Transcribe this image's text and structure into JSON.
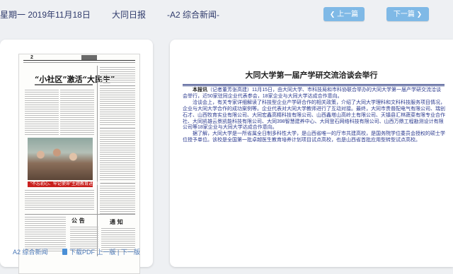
{
  "header": {
    "date": "星期一 2019年11月18日",
    "paper_name": "大同日报",
    "page_label": "-A2 综合新闻-",
    "prev_label": "上一篇",
    "next_label": "下一篇",
    "button_color": "#7fb9e6"
  },
  "thumbnail": {
    "page_number": "2",
    "headline": "“小社区”激活“大民生”",
    "red_band_text": "“不忘初心、牢记使命”主题教育进行时",
    "notices": [
      "公  告",
      "通  知"
    ],
    "footer_page": "A2 综合新闻",
    "footer_links": "下载PDF 上一版 | 下一版"
  },
  "article": {
    "title": "大同大学第一届产学研交流洽谈会举行",
    "lead": "本报讯",
    "paragraphs": [
      "（记者董芳张高建）11月15日，由大同大学、市科技局和市科协联合举办的大同大学第一届产学研交流洽谈会举行，近50家驻同企业代表参会，18家企业与大同大学达成合作意向。",
      "洽谈会上，有关专家详细解读了科技型企业产学研合作的相关政策，介绍了大同大学理科和文科科技服务项目情况，企业与大同大学合作的成功案例等。企业代表对大同大学教师进行了互动对接。最终，大同市贵普配电气有限公司、瑞创石才、山西牧育实业有限公司、大同宏鑫高精科技有限公司、山西鑫塔山高岭土有限公司、天镇县汇林蔬菜有限专业合作社、大同凯雄云景凯能科技有限公司、大同398智慧建养中心、大同登石网络科技有限公司、山西万鼎工程勘测设计有限公司等18家企业与大同大学达成合作意向。",
      "据了解，大同大学是一所省属全日制多科性大学，是山西省唯一的厅市共建高校，是国务院学位委员会授权的硕士学位授予单位。该校是全国第一批卓越医生教育培养计划项目试点高校，也是山西省首批应用型转型试点高校。"
    ],
    "rule_color": "#1b2b77",
    "text_color": "#2b3a8f"
  }
}
